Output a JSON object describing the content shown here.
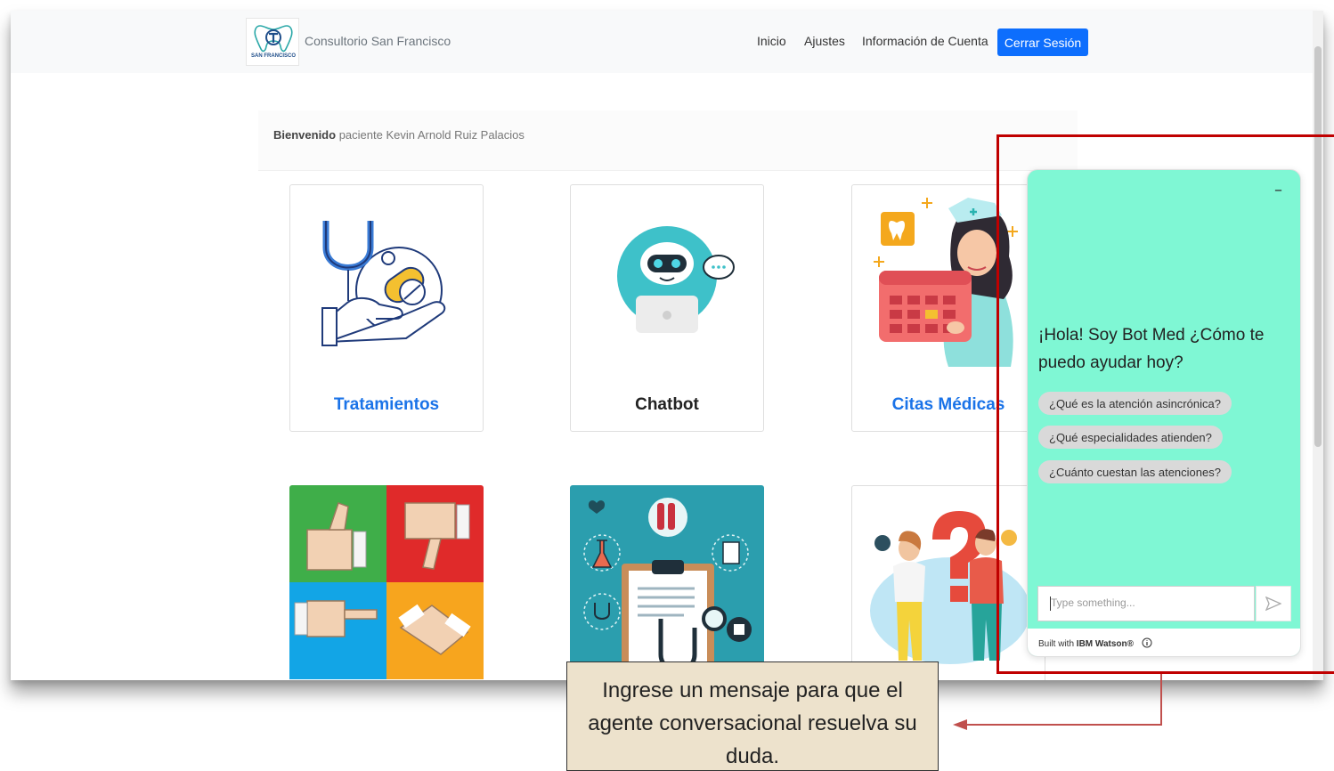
{
  "navbar": {
    "brand": "Consultorio San Francisco",
    "logo_text": "SAN FRANCISCO",
    "links": [
      "Inicio",
      "Ajustes",
      "Información de Cuenta"
    ],
    "logout": "Cerrar Sesión"
  },
  "welcome": {
    "bold": "Bienvenido",
    "text": "paciente Kevin Arnold Ruiz Palacios"
  },
  "cards": [
    {
      "title": "Tratamientos",
      "color": "#1a73e8"
    },
    {
      "title": "Chatbot",
      "color": "#222222"
    },
    {
      "title": "Citas Médicas",
      "color": "#1a73e8"
    }
  ],
  "chat": {
    "minimize": "–",
    "greeting": "¡Hola! Soy Bot Med ¿Cómo te puedo ayudar hoy?",
    "options": [
      "¿Qué es la atención asincrónica?",
      "¿Qué especialidades atienden?",
      "¿Cuánto cuestan las atenciones?"
    ],
    "input_placeholder": "Type something...",
    "footer_prefix": "Built with",
    "footer_brand": "IBM Watson®"
  },
  "callout": "Ingrese un mensaje para que el agente conversacional resuelva su duda.",
  "colors": {
    "primary": "#0d6efd",
    "chat_bg": "#7ff7d4",
    "highlight": "#c00000",
    "callout_bg": "#ede2cc"
  }
}
